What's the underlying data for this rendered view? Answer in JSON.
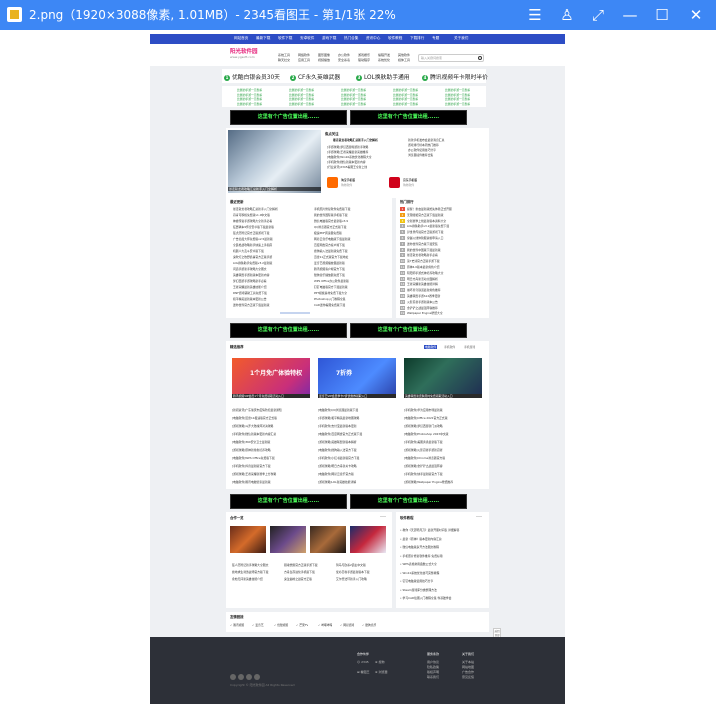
{
  "titlebar": {
    "title": "2.png（1920×3088像素, 1.01MB）- 2345看图王 - 第1/1张 22%"
  },
  "nav": {
    "items": [
      "网站首页",
      "最新下载",
      "软件下载",
      "安卓软件",
      "游戏下载",
      "热门合集",
      "资讯中心",
      "软件教程",
      "下载排行",
      "专题",
      "关于我们"
    ]
  },
  "header": {
    "logo": "阳光软件园",
    "logo_sub": "www.ygsoft.com",
    "search_placeholder": "输入关键词搜索",
    "cats": [
      [
        "系统工具",
        "聊天社交"
      ],
      [
        "网络软件",
        "应用工具"
      ],
      [
        "图形图像",
        "视频播放"
      ],
      [
        "办公软件",
        "安全杀毒"
      ],
      [
        "游戏娱乐",
        "驱动程序"
      ],
      [
        "编程开发",
        "系统优化"
      ],
      [
        "其他软件",
        "媒体工具"
      ]
    ]
  },
  "promos": [
    {
      "n": "1",
      "t": "优酷白银会员30天"
    },
    {
      "n": "2",
      "t": "CF永久英雄武器"
    },
    {
      "n": "3",
      "t": "LOL换肤助手通用"
    },
    {
      "n": "4",
      "t": "腾讯视频年卡限时半价"
    }
  ],
  "linkgrid": [
    "比赛的手游一元秒杀",
    "比赛的手游一元秒杀",
    "比赛的手游一元秒杀",
    "比赛的手游一元秒杀",
    "比赛的手游一元秒杀",
    "比赛的手游一元秒杀",
    "比赛的手游一元秒杀",
    "比赛的手游一元秒杀",
    "比赛的手游一元秒杀",
    "比赛的手游一元秒杀",
    "比赛的手游一元秒杀",
    "比赛的手游一元秒杀",
    "比赛的手游一元秒杀",
    "比赛的手游一元秒杀",
    "比赛的手游一元秒杀",
    "比赛的手游一元秒杀",
    "比赛的手游一元秒杀",
    "比赛的手游一元秒杀",
    "比赛的手游一元秒杀",
    "比赛的手游一元秒杀"
  ],
  "ad_text": "这里有个广告位置出租......",
  "focus": {
    "title": "焦点关注",
    "headline": "暴走斩龙者攻略汇总新手入门全解析",
    "news": [
      "[手游攻略]梦幻西游端游新手攻略",
      "[手游攻略]王者荣耀最新英雄推荐",
      "[电脑软件]Win10系统优化教程大全",
      "[手机软件]微信新版本更新内容",
      "[行业资讯]2345看图王全新上线"
    ],
    "side_news": [
      "新款手机发布会最新消息汇总",
      "游戏排行榜本周热门推荐",
      "办公软件使用技巧分享",
      "浏览器插件推荐合集"
    ],
    "apps": [
      {
        "name": "淘宝手机版",
        "sub": "购物软件"
      },
      {
        "name": "京东手机版",
        "sub": "购物软件"
      }
    ]
  },
  "latest": {
    "title": "最近更新",
    "left": [
      "暴走斩龙者攻略汇总新手入门全解析",
      "丹青可移植免费版v1.0中文版",
      "神魔传说手游攻略大全新手必看",
      "狂野飙车9传奇安卓版下载最新版",
      "猛犬历险记官方正版游戏下载",
      "广告拦截大师免费版v2.5最新版",
      "全民枪战攻略新手快速上手指南",
      "机器人大乱斗安卓版下载",
      "鬼吹灯之牧野诡事官方正版手游",
      "LOL换肤助手免费版v3.2最新版",
      "问道手游新手攻略大全图文",
      "英雄联盟手游新版本更新内容",
      "梦幻西游手游攻略新手必看",
      "王者荣耀最新英雄技能介绍",
      "DNF游戏辅助工具免费下载",
      "和平精英最新版本更新公告",
      "迷你世界官方正版下载最新版"
    ],
    "mid": [
      "手机照片修复软件免费版下载",
      "我的世界国际版手机版下载",
      "微信电脑版官方最新版v3.9",
      "QQ浏览器官方正式版下载",
      "极速PDF阅读器免费版",
      "网易云音乐电脑版下载最新版",
      "百度网盘官方客户端下载",
      "搜狗输入法最新版免费下载",
      "迅雷11正式版官方下载地址",
      "爱奇艺视频播放器最新版",
      "腾讯视频客户端官方下载",
      "酷狗音乐播放器免费下载",
      "WPS Office办公软件最新版",
      "钉钉电脑版官方下载最新版",
      "PPT模板素材免费下载大全",
      "Photoshop入门教程全集",
      "CAD迷你看图免费版下载"
    ]
  },
  "hot": {
    "title": "热门排行",
    "items": [
      "提醒！重启最新版抢先体验正式开服",
      "无限暖暖官方正版下载最新版",
      "全新赛季上线最新版本资料大全",
      "LOL换肤助手v3.2最新版免费下载",
      "异世界传说官方正版游戏下载",
      "穿越火线体验服资格申请入口",
      "迷你世界官方版下载安装",
      "我的世界中国版下载最新版",
      "暴走斩龙者攻略新手必看",
      "第7史诗官方正版手游下载",
      "原神4.0版本最新角色介绍",
      "阴阳师手游式神培养攻略大全",
      "明日方舟新活动全面解析",
      "王者荣耀新英雄技能详解",
      "崩坏星穹铁道最新角色推荐",
      "英雄联盟手游S12赛季更新",
      "火影忍者手游新版本公告",
      "金铲铲之战最强阵容推荐",
      "Wallpaper Engine壁纸大全"
    ]
  },
  "special": {
    "title": "精选推荐",
    "tabs": [
      "电脑软件",
      "手机软件",
      "手机游戏"
    ],
    "banners": [
      {
        "big": "1个月免广体验特权",
        "cap": "腾讯视频VIP会员1个月免费领取活动入口"
      },
      {
        "big": "7折券",
        "cap": "爱奇艺VIP会员季卡7折优惠券领取入口"
      },
      {
        "big": "",
        "cap": "英雄联盟新皮肤限时免费领取活动入口"
      }
    ],
    "col1": [
      "[新闻资讯]广东肇庆市疫情防控最新通知",
      "[电脑软件]迅雷11极速版官方正式版",
      "[游戏攻略]斗罗大陆魂师对决攻略",
      "[手机软件]微信新版本更新内容汇总",
      "[电脑软件]360安全卫士最新版",
      "[游戏攻略]原神新角色培养攻略",
      "[电脑软件]WPS Office免费版下载",
      "[手机软件]抖音最新版官方下载",
      "[游戏攻略]王者荣耀新赛季上分攻略",
      "[电脑软件]腾讯电脑管家最新版"
    ],
    "col2": [
      "[电脑软件]QQ浏览器最新版下载",
      "[手游攻略]和平精英最新地图攻略",
      "[手机软件]支付宝最新版本更新",
      "[电脑软件]百度网盘官方正式版下载",
      "[游戏攻略]英雄联盟新版本解析",
      "[电脑软件]搜狗输入法官方下载",
      "[手机软件]小红书最新版官方下载",
      "[游戏攻略]明日方舟新关卡攻略",
      "[电脑软件]网易云音乐官方版",
      "[游戏攻略]LOL新英雄技能详解"
    ],
    "col3": [
      "[手机软件]华为应用市场最新版",
      "[电脑软件]Office 2021官方正式版",
      "[游戏攻略]梦幻西游新门派攻略",
      "[电脑软件]Photoshop 2023中文版",
      "[手机软件]美图秀秀最新版下载",
      "[游戏攻略]火影忍者手游新忍者",
      "[电脑软件]Chrome浏览器官方版",
      "[游戏攻略]金铲铲之战最强阵容",
      "[手机软件]快手最新版官方下载",
      "[游戏攻略]Wallpaper Engine壁纸推荐"
    ]
  },
  "games": {
    "title": "合作一览",
    "more": "•••",
    "items": [
      "猛人历险记新手攻略大全图文",
      "绝地求生刺激战场官方版下载",
      "永劫无间新英雄技能介绍",
      "猎魂觉醒官方正版手游下载",
      "方舟生存进化手机版下载",
      "鬼泣巅峰之战官方正版",
      "骑马与砍杀2霸主中文版",
      "使命召唤手游最新版本下载",
      "艾尔登法环新手入门攻略"
    ]
  },
  "tutorial": {
    "title": "软件教程",
    "more": "•••",
    "items": [
      "教你《天涯明月刀》最新开服时间表 详细解答",
      "最新《原神》版本更新内容汇总",
      "微信电脑版多开方法图文教程",
      "手机照片修复软件推荐 免费好用",
      "WPS表格常用函数公式大全",
      "Win10系统优化技巧完整教程",
      "钉钉电脑版使用技巧分享",
      "Steam游戏库分类整理方法",
      "学习CAD绘图入门教程全集 零基础学会"
    ]
  },
  "links": {
    "title": "友情链接",
    "items": [
      "✓ 腾讯视频",
      "✓ 爱奇艺",
      "✓ 优酷视频",
      "✓ 芒果TV",
      "✓ 哔哩哔哩",
      "✓ 网易游戏",
      "✓ 酷狗音乐"
    ]
  },
  "footer": {
    "col_titles": [
      "合作伙伴",
      "服务条款",
      "关于我们"
    ],
    "partners": [
      "☺ 2345",
      "⊕ 搜狗",
      "⊞ 看图王",
      "⊕ 浏览器"
    ],
    "terms": [
      "用户协议",
      "隐私政策",
      "版权声明",
      "联系我们"
    ],
    "about": [
      "关于本站",
      "网站地图",
      "广告合作",
      "意见反馈"
    ],
    "copyright": "Copyright © 阳光软件园 All Rights Reserved",
    "back_top": "返回顶部"
  }
}
